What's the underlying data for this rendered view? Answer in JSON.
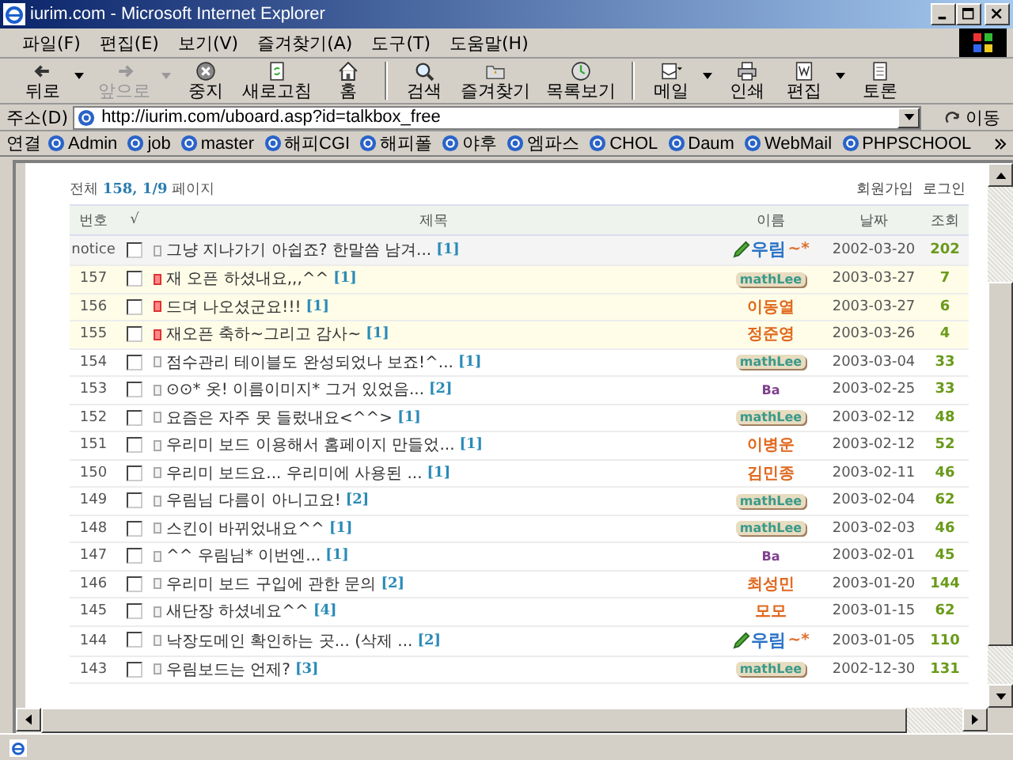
{
  "window": {
    "title": "iurim.com - Microsoft Internet Explorer"
  },
  "menu": [
    "파일(F)",
    "편집(E)",
    "보기(V)",
    "즐겨찾기(A)",
    "도구(T)",
    "도움말(H)"
  ],
  "toolbar": [
    {
      "kind": "back",
      "label": "뒤로",
      "disabled": false,
      "dropdown": true
    },
    {
      "kind": "forward",
      "label": "앞으로",
      "disabled": true,
      "dropdown": true
    },
    {
      "kind": "stop",
      "label": "중지",
      "disabled": false,
      "dropdown": false
    },
    {
      "kind": "refresh",
      "label": "새로고침",
      "disabled": false,
      "dropdown": false
    },
    {
      "kind": "home",
      "label": "홈",
      "disabled": false,
      "dropdown": false
    },
    {
      "kind": "search",
      "label": "검색",
      "disabled": false,
      "dropdown": false
    },
    {
      "kind": "favorites",
      "label": "즐겨찾기",
      "disabled": false,
      "dropdown": false
    },
    {
      "kind": "history",
      "label": "목록보기",
      "disabled": false,
      "dropdown": false
    },
    {
      "kind": "mail",
      "label": "메일",
      "disabled": false,
      "dropdown": true
    },
    {
      "kind": "print",
      "label": "인쇄",
      "disabled": false,
      "dropdown": false
    },
    {
      "kind": "edit",
      "label": "편집",
      "disabled": false,
      "dropdown": true
    },
    {
      "kind": "discuss",
      "label": "토론",
      "disabled": false,
      "dropdown": false
    }
  ],
  "address": {
    "label": "주소(D)",
    "url": "http://iurim.com/uboard.asp?id=talkbox_free",
    "go": "이동"
  },
  "links": {
    "label": "연결",
    "items": [
      "Admin",
      "job",
      "master",
      "해피CGI",
      "해피폴",
      "야후",
      "엠파스",
      "CHOL",
      "Daum",
      "WebMail",
      "PHPSCHOOL"
    ]
  },
  "board": {
    "summary": "전체 **158, 1/9** 페이지",
    "actions": [
      "회원가입",
      "로그인"
    ],
    "columns": [
      "번호",
      "√",
      "제목",
      "이름",
      "날짜",
      "조회"
    ],
    "rows": [
      {
        "kind": "notice",
        "number": "notice",
        "checked": false,
        "new": false,
        "title": "그냥 지나가기 아쉽죠? 한말씀 남겨...",
        "comments": "[1]",
        "author": {
          "kind": "admin",
          "text": "우림",
          "suffix": "~*"
        },
        "date": "2002-03-20",
        "views": "202"
      },
      {
        "kind": "post",
        "number": "157",
        "checked": false,
        "new": true,
        "title": "재 오픈 하셨내요,,,^^",
        "comments": "[1]",
        "author": {
          "kind": "badge",
          "text": "mathLee"
        },
        "date": "2003-03-27",
        "views": "7"
      },
      {
        "kind": "post",
        "number": "156",
        "checked": false,
        "new": true,
        "title": "드뎌 나오셨군요!!!",
        "comments": "[1]",
        "author": {
          "kind": "name",
          "text": "이동열"
        },
        "date": "2003-03-27",
        "views": "6"
      },
      {
        "kind": "post",
        "number": "155",
        "checked": false,
        "new": true,
        "title": "재오픈 축하~그리고 감사~",
        "comments": "[1]",
        "author": {
          "kind": "name",
          "text": "정준영"
        },
        "date": "2003-03-26",
        "views": "4"
      },
      {
        "kind": "post",
        "number": "154",
        "checked": false,
        "new": false,
        "title": "점수관리 테이블도 완성되었나 보죠!^...",
        "comments": "[1]",
        "author": {
          "kind": "badge",
          "text": "mathLee"
        },
        "date": "2003-03-04",
        "views": "33"
      },
      {
        "kind": "post",
        "number": "153",
        "checked": false,
        "new": false,
        "title": "⊙⊙* 옷! 이름이미지* 그거 있었음...",
        "comments": "[2]",
        "author": {
          "kind": "tag",
          "text": "Ba"
        },
        "date": "2003-02-25",
        "views": "33"
      },
      {
        "kind": "post",
        "number": "152",
        "checked": false,
        "new": false,
        "title": "요즘은 자주 못 들렀내요<^^>",
        "comments": "[1]",
        "author": {
          "kind": "badge",
          "text": "mathLee"
        },
        "date": "2003-02-12",
        "views": "48"
      },
      {
        "kind": "post",
        "number": "151",
        "checked": false,
        "new": false,
        "title": "우리미 보드 이용해서 홈페이지 만들었...",
        "comments": "[1]",
        "author": {
          "kind": "name",
          "text": "이병운"
        },
        "date": "2003-02-12",
        "views": "52"
      },
      {
        "kind": "post",
        "number": "150",
        "checked": false,
        "new": false,
        "title": "우리미 보드요... 우리미에 사용된 ...",
        "comments": "[1]",
        "author": {
          "kind": "name",
          "text": "김민종"
        },
        "date": "2003-02-11",
        "views": "46"
      },
      {
        "kind": "post",
        "number": "149",
        "checked": false,
        "new": false,
        "title": "우림님 다름이 아니고요!",
        "comments": "[2]",
        "author": {
          "kind": "badge",
          "text": "mathLee"
        },
        "date": "2003-02-04",
        "views": "62"
      },
      {
        "kind": "post",
        "number": "148",
        "checked": false,
        "new": false,
        "title": "스킨이 바뀌었내요^^",
        "comments": "[1]",
        "author": {
          "kind": "badge",
          "text": "mathLee"
        },
        "date": "2003-02-03",
        "views": "46"
      },
      {
        "kind": "post",
        "number": "147",
        "checked": false,
        "new": false,
        "title": "^^ 우림님* 이번엔...",
        "comments": "[1]",
        "author": {
          "kind": "tag",
          "text": "Ba"
        },
        "date": "2003-02-01",
        "views": "45"
      },
      {
        "kind": "post",
        "number": "146",
        "checked": false,
        "new": false,
        "title": "우리미 보드 구입에 관한 문의",
        "comments": "[2]",
        "author": {
          "kind": "name",
          "text": "최성민"
        },
        "date": "2003-01-20",
        "views": "144"
      },
      {
        "kind": "post",
        "number": "145",
        "checked": false,
        "new": false,
        "title": "새단장 하셨네요^^",
        "comments": "[4]",
        "author": {
          "kind": "name",
          "text": "모모"
        },
        "date": "2003-01-15",
        "views": "62"
      },
      {
        "kind": "post",
        "number": "144",
        "checked": false,
        "new": false,
        "title": "낙장도메인 확인하는 곳... (삭제 ...",
        "comments": "[2]",
        "author": {
          "kind": "admin",
          "text": "우림",
          "suffix": "~*"
        },
        "date": "2003-01-05",
        "views": "110"
      },
      {
        "kind": "post",
        "number": "143",
        "checked": false,
        "new": false,
        "title": "우림보드는 언제?",
        "comments": "[3]",
        "author": {
          "kind": "badge",
          "text": "mathLee"
        },
        "date": "2002-12-30",
        "views": "131"
      }
    ]
  }
}
